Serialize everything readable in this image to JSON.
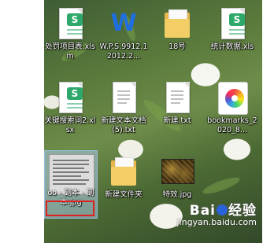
{
  "desktop": {
    "icons": [
      {
        "label": "处罚项目表.xlsm",
        "icon": "spreadsheet-icon",
        "badge": "S"
      },
      {
        "label": "W.P.S.9912.12012.2...",
        "icon": "wps-icon",
        "badge": "W"
      },
      {
        "label": "18号",
        "icon": "folder-icon"
      },
      {
        "label": "统计数据.xls",
        "icon": "spreadsheet-icon",
        "badge": "S"
      },
      {
        "label": "关键搜索词2.xlsx",
        "icon": "spreadsheet-icon",
        "badge": "S"
      },
      {
        "label": "新建文本文档 (5).txt",
        "icon": "text-file-icon"
      },
      {
        "label": "新建.txt",
        "icon": "text-file-icon"
      },
      {
        "label": "bookmarks_2020_8...",
        "icon": "bookmark-app-icon"
      },
      {
        "label": "oo - 副本 - 副本.jpg",
        "icon": "image-file-icon"
      },
      {
        "label": "新建文件夹",
        "icon": "folder-icon"
      },
      {
        "label": "特效.jpg",
        "icon": "image-file-icon"
      }
    ],
    "selected_index": 8
  },
  "watermark": {
    "brand_left": "Bai",
    "brand_right": "经验",
    "sub": "jingyan.baidu.com"
  },
  "colors": {
    "highlight": "#e02020",
    "selection": "#aac8e6"
  }
}
